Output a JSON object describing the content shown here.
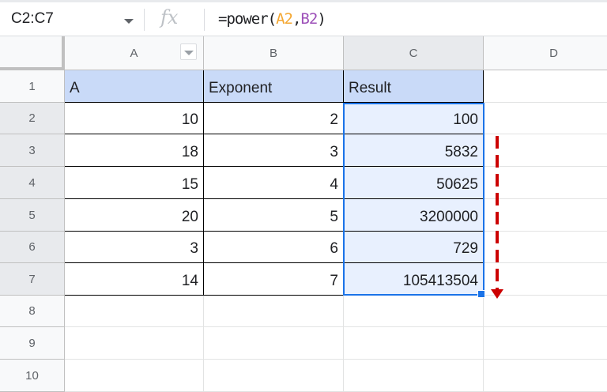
{
  "formula_bar": {
    "name_box": "C2:C7",
    "fx": "fx",
    "formula_prefix": "=power(",
    "ref1": "A2",
    "comma": ",",
    "ref2": "B2",
    "formula_suffix": ")",
    "ref1_color": "#f4a731",
    "ref2_color": "#9c4fb8"
  },
  "columns": [
    "A",
    "B",
    "C",
    "D"
  ],
  "rows": [
    "1",
    "2",
    "3",
    "4",
    "5",
    "6",
    "7",
    "8",
    "9",
    "10"
  ],
  "headers": [
    "A",
    "Exponent",
    "Result"
  ],
  "data": [
    {
      "a": "10",
      "b": "2",
      "c": "100"
    },
    {
      "a": "18",
      "b": "3",
      "c": "5832"
    },
    {
      "a": "15",
      "b": "4",
      "c": "50625"
    },
    {
      "a": "20",
      "b": "5",
      "c": "3200000"
    },
    {
      "a": "3",
      "b": "6",
      "c": "729"
    },
    {
      "a": "14",
      "b": "7",
      "c": "105413504"
    }
  ],
  "colors": {
    "selection": "#1a73e8",
    "header_fill": "#c9daf8",
    "arrow": "#cc0000"
  }
}
